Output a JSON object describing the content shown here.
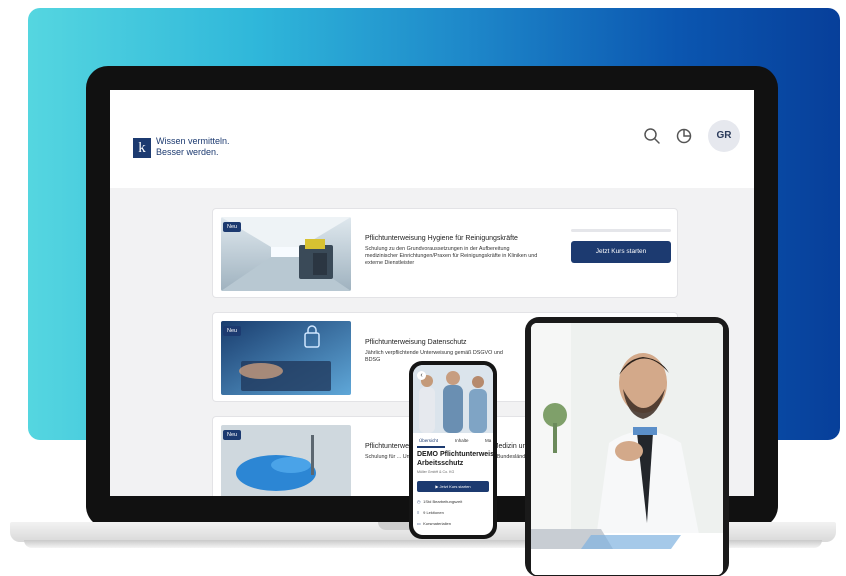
{
  "app": {
    "logo_letter": "k",
    "tagline_line1": "Wissen vermitteln.",
    "tagline_line2": "Besser werden.",
    "user_initials": "GR",
    "header_icons": [
      "search-icon",
      "pie-chart-icon"
    ]
  },
  "courses": [
    {
      "badge": "Neu",
      "title": "Pflichtunterweisung Hygiene für Reinigungskräfte",
      "description": "Schulung zu den Grundvoraussetzungen in der Aufbereitung medizinischer Einrichtungen/Praxen für Reinigungskräfte in Kliniken und externe Dienstleister",
      "button": "Jetzt Kurs starten"
    },
    {
      "badge": "Neu",
      "title": "Pflichtunterweisung Datenschutz",
      "description": "Jährlich verpflichtende Unterweisung gemäß DSGVO und BDSG"
    },
    {
      "badge": "Neu",
      "title": "Pflichtunterweisung Arbeitsschutz für die Medizin und",
      "description": "Schulung für ... Unterweisung gemäß ... der Medizin ... Bundesländer"
    }
  ],
  "mobile": {
    "tabs": [
      "Übersicht",
      "Inhalte",
      "Ma"
    ],
    "title_line1": "DEMO Pflichtunterweisung",
    "title_line2": "Arbeitsschutz",
    "subtitle": "Müller GmbH & Co. KG",
    "start_button": "Jetzt Kurs starten",
    "rows": [
      "1Std Bearbeitungszeit",
      "9 Lektionen",
      "Kursmaterialien"
    ]
  },
  "colors": {
    "brand": "#1c3a70",
    "gradient_start": "#55d6e0",
    "gradient_end": "#073f9a"
  }
}
